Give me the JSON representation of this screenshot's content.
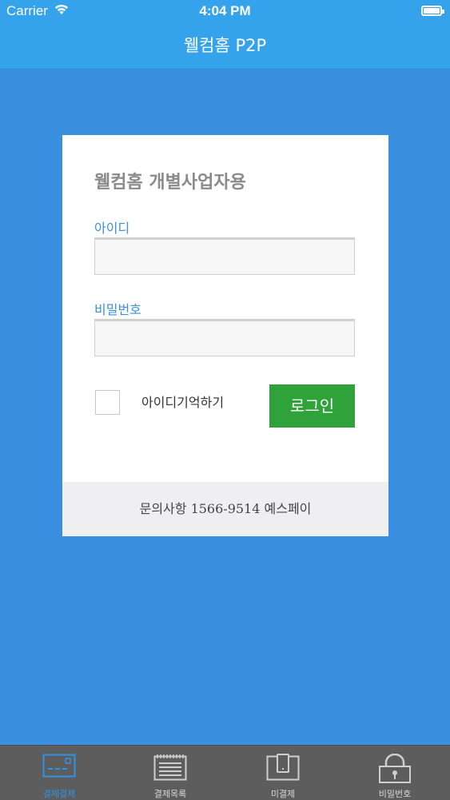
{
  "status_bar": {
    "carrier": "Carrier",
    "time": "4:04 PM"
  },
  "nav": {
    "title": "웰컴홈 P2P"
  },
  "login": {
    "title": "웰컴홈 개별사업자용",
    "id_label": "아이디",
    "id_value": "",
    "password_label": "비밀번호",
    "password_value": "",
    "remember_label": "아이디기억하기",
    "login_button": "로그인",
    "footer_text": "문의사항 1566-9514 예스페이"
  },
  "tabs": [
    {
      "label": "결제결제",
      "icon": "card-terminal-icon",
      "active": true
    },
    {
      "label": "결제목록",
      "icon": "list-icon",
      "active": false
    },
    {
      "label": "미결제",
      "icon": "phone-document-icon",
      "active": false
    },
    {
      "label": "비밀번호",
      "icon": "lock-icon",
      "active": false
    }
  ],
  "colors": {
    "background": "#3a8fe0",
    "nav": "#35a3ec",
    "login_button": "#2fa239",
    "tabbar": "#5d5d5d",
    "active_tab": "#2e93e6"
  }
}
